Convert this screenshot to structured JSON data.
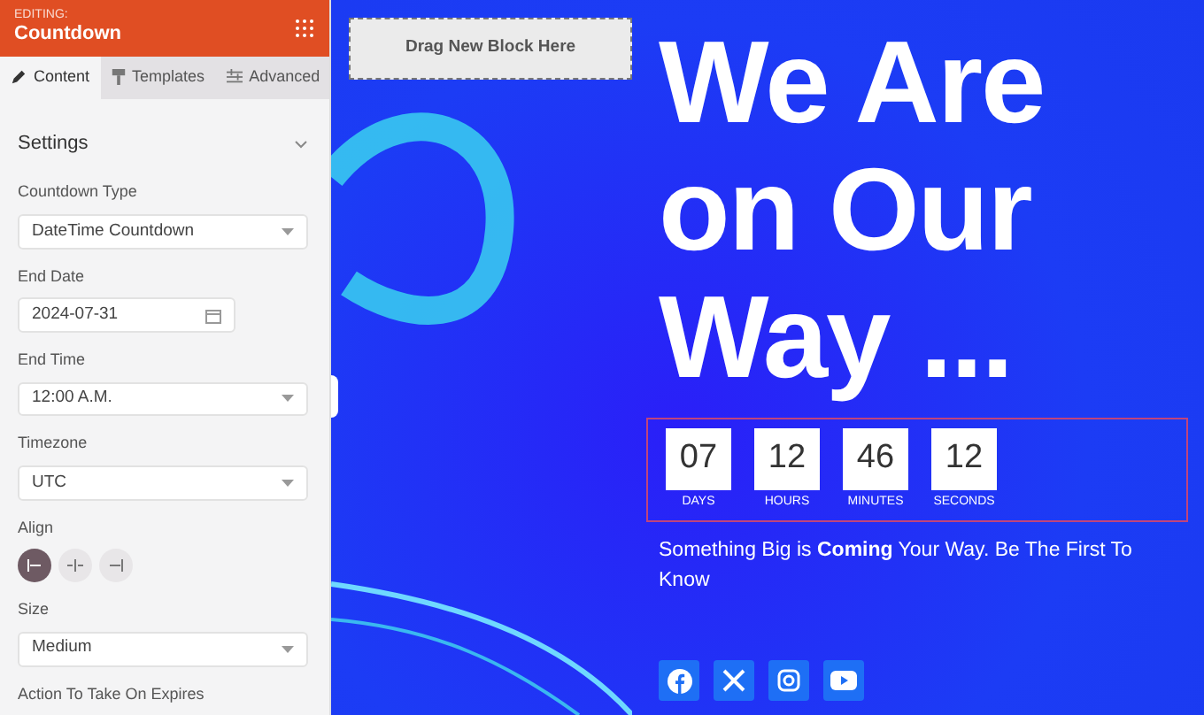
{
  "panel": {
    "caption": "EDITING:",
    "title": "Countdown"
  },
  "tabs": [
    {
      "label": "Content",
      "selected": true
    },
    {
      "label": "Templates",
      "selected": false
    },
    {
      "label": "Advanced",
      "selected": false
    }
  ],
  "section": {
    "title": "Settings",
    "expanded": true
  },
  "fields": [
    {
      "kind": "select",
      "label": "Countdown Type",
      "value": "DateTime Countdown"
    },
    {
      "kind": "date",
      "label": "End Date",
      "value": "2024-07-31"
    },
    {
      "kind": "select",
      "label": "End Time",
      "value": "12:00 A.M."
    },
    {
      "kind": "select",
      "label": "Timezone",
      "value": "UTC"
    },
    {
      "kind": "align",
      "label": "Align",
      "options": [
        {
          "kind": "left",
          "selected": true
        },
        {
          "kind": "center",
          "selected": false
        },
        {
          "kind": "right",
          "selected": false
        }
      ]
    },
    {
      "kind": "select",
      "label": "Size",
      "value": "Medium"
    },
    {
      "kind": "label",
      "label": "Action To Take On Expires"
    }
  ],
  "canvas": {
    "drop_zone": "Drag New Block Here",
    "heading": [
      "We Are",
      "on Our",
      "Way ..."
    ],
    "countdown": [
      {
        "value": "07",
        "unit": "DAYS"
      },
      {
        "value": "12",
        "unit": "HOURS"
      },
      {
        "value": "46",
        "unit": "MINUTES"
      },
      {
        "value": "12",
        "unit": "SECONDS"
      }
    ],
    "tagline": "Something Big is **Coming** Your Way. Be The First To Know",
    "social": [
      {
        "kind": "facebook"
      },
      {
        "kind": "x"
      },
      {
        "kind": "instagram"
      },
      {
        "kind": "youtube"
      }
    ]
  }
}
